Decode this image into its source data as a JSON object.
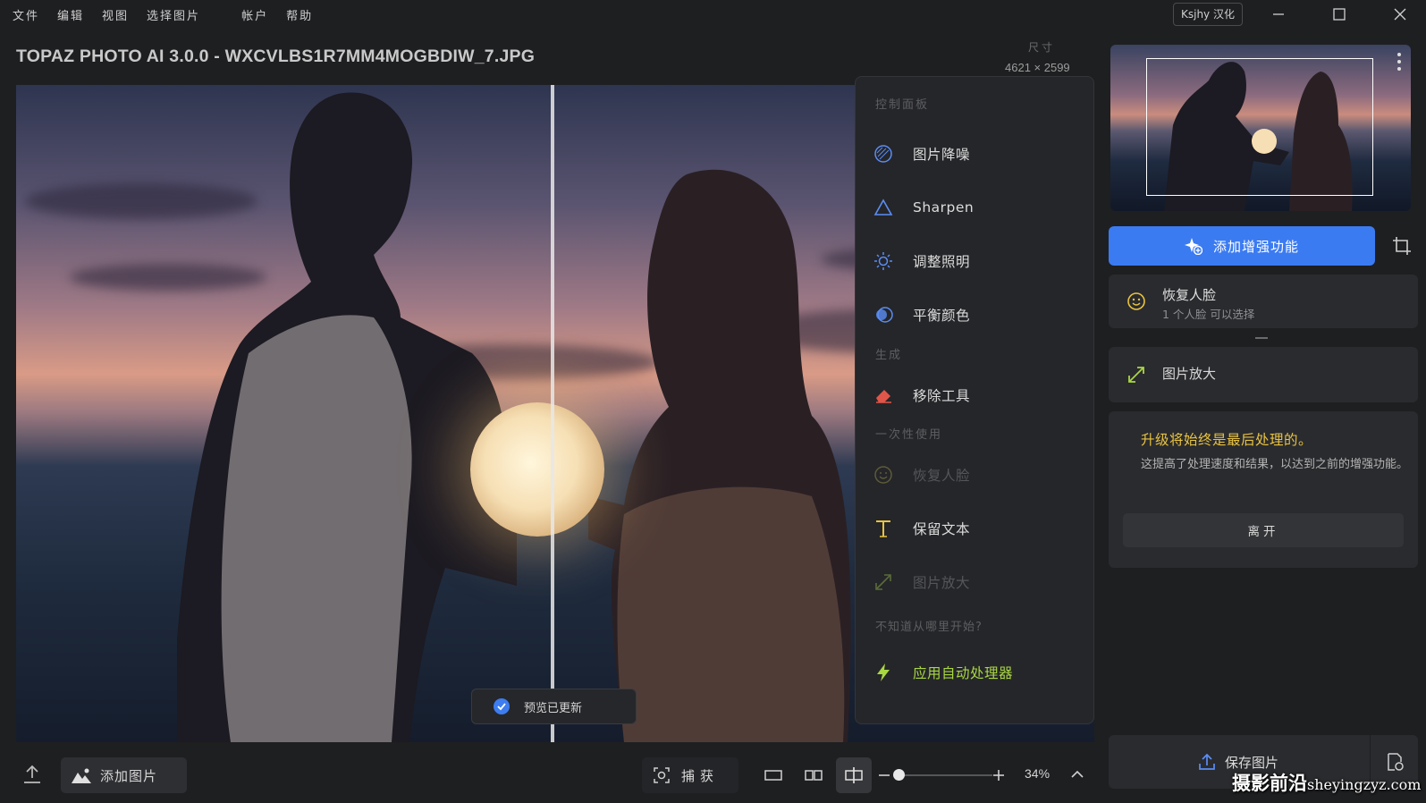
{
  "menubar": {
    "items": [
      "文件",
      "编辑",
      "视图",
      "选择图片",
      "帐户",
      "帮助"
    ],
    "badge": "Ksjhy 汉化"
  },
  "header": {
    "title": "TOPAZ PHOTO AI 3.0.0 - WXCVLBS1R7MM4MOGBDIW_7.JPG",
    "dimension_label": "尺寸",
    "dimension_value": "4621 × 2599"
  },
  "preview": {
    "toast": "预览已更新"
  },
  "control_panel": {
    "title": "控制面板",
    "items": [
      {
        "label": "图片降噪",
        "icon": "denoise-icon"
      },
      {
        "label": "Sharpen",
        "icon": "triangle-icon"
      },
      {
        "label": "调整照明",
        "icon": "sun-icon"
      },
      {
        "label": "平衡颜色",
        "icon": "color-balance-icon"
      }
    ],
    "generate_label": "生成",
    "generate_items": [
      {
        "label": "移除工具",
        "icon": "eraser-icon"
      }
    ],
    "once_label": "一次性使用",
    "once_items": [
      {
        "label": "恢复人脸",
        "icon": "face-icon",
        "disabled": true
      },
      {
        "label": "保留文本",
        "icon": "text-icon",
        "disabled": false
      },
      {
        "label": "图片放大",
        "icon": "upscale-icon",
        "disabled": true
      }
    ],
    "help_label": "不知道从哪里开始?",
    "auto_label": "应用自动处理器"
  },
  "right_panel": {
    "add_enhancement": "添加增强功能",
    "face_card": {
      "title": "恢复人脸",
      "subtitle": "1 个人脸 可以选择"
    },
    "upscale_card": {
      "title": "图片放大"
    },
    "info_card": {
      "title": "升级将始终是最后处理的。",
      "body": "这提高了处理速度和结果，以达到之前的增强功能。",
      "leave": "离开"
    },
    "save": "保存图片"
  },
  "bottombar": {
    "add_image": "添加图片",
    "capture": "捕获",
    "zoom_percent": "34%",
    "zoom_level": 0.05
  },
  "watermark": {
    "cn": "摄影前沿",
    "url": "sheyingzyz.com"
  },
  "colors": {
    "accent": "#3b7bf2",
    "auto": "#a9d742",
    "warning": "#e8c341"
  }
}
